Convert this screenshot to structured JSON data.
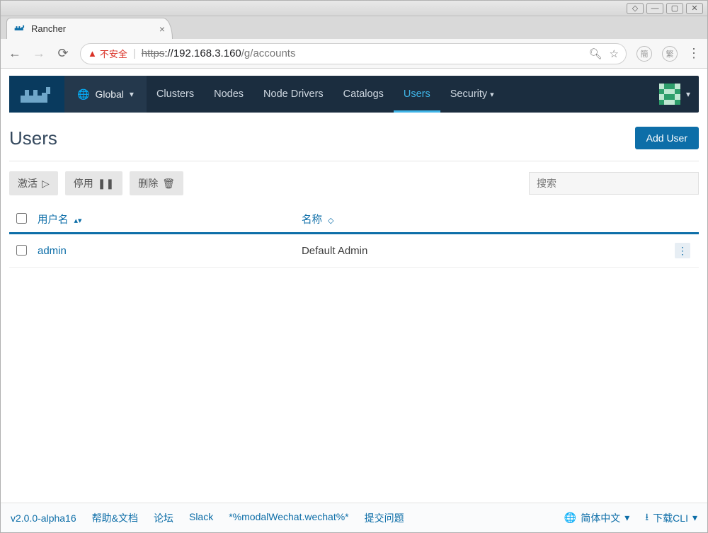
{
  "browser": {
    "tab_title": "Rancher",
    "insecure_label": "不安全",
    "url_scheme": "https",
    "url_rest": "://192.168.3.160",
    "url_path": "/g/accounts"
  },
  "nav": {
    "scope": "Global",
    "items": [
      "Clusters",
      "Nodes",
      "Node Drivers",
      "Catalogs",
      "Users",
      "Security"
    ],
    "active": "Users",
    "dropdown_after": [
      "Security"
    ]
  },
  "page": {
    "title": "Users",
    "add_button": "Add User"
  },
  "toolbar": {
    "activate": "激活",
    "deactivate": "停用",
    "delete": "删除",
    "search_placeholder": "搜索"
  },
  "table": {
    "columns": {
      "username": "用户名",
      "name": "名称"
    },
    "rows": [
      {
        "username": "admin",
        "name": "Default Admin"
      }
    ]
  },
  "footer": {
    "version": "v2.0.0-alpha16",
    "links": [
      "帮助&文档",
      "论坛",
      "Slack",
      "*%modalWechat.wechat%*",
      "提交问题"
    ],
    "language": "简体中文",
    "download": "下载CLI"
  }
}
